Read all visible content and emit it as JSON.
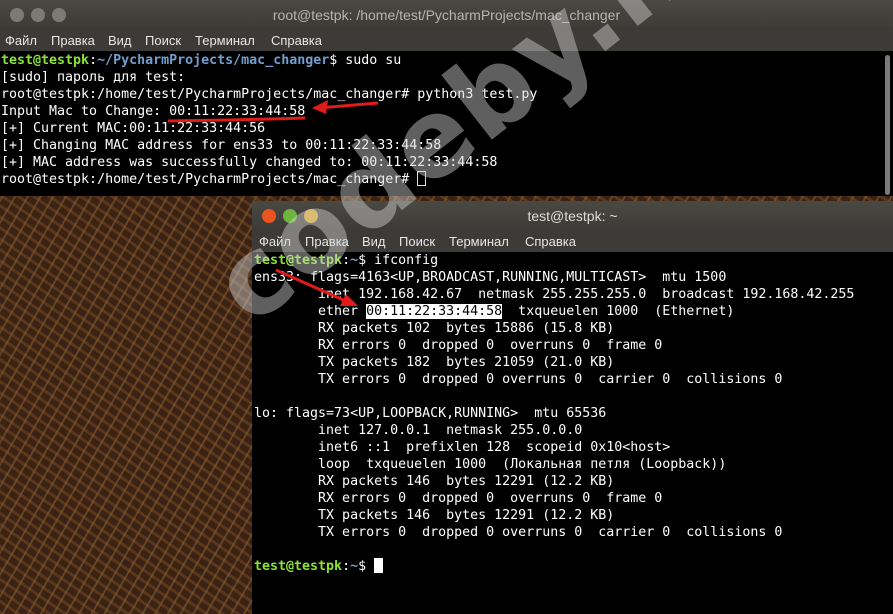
{
  "watermark": "codeby.net",
  "window1": {
    "title": "root@testpk: /home/test/PycharmProjects/mac_changer",
    "menu": [
      "Файл",
      "Правка",
      "Вид",
      "Поиск",
      "Терминал",
      "Справка"
    ],
    "lines": [
      {
        "user": "test@testpk",
        "path": "~/PycharmProjects/mac_changer",
        "prompt": "$ ",
        "text": "sudo su"
      },
      {
        "text": "[sudo] пароль для test:"
      },
      {
        "text": "root@testpk:/home/test/PycharmProjects/mac_changer# python3 test.py"
      },
      {
        "pre": "Input Mac to Change: ",
        "mac": "00:11:22:33:44:58"
      },
      {
        "text": "[+] Current MAC:00:11:22:33:44:56"
      },
      {
        "text": "[+] Changing MAC address for ens33 to 00:11:22:33:44:58"
      },
      {
        "text": "[+] MAC address was successfully changed to: 00:11:22:33:44:58"
      },
      {
        "text": "root@testpk:/home/test/PycharmProjects/mac_changer# "
      }
    ]
  },
  "window2": {
    "title": "test@testpk: ~",
    "menu": [
      "Файл",
      "Правка",
      "Вид",
      "Поиск",
      "Терминал",
      "Справка"
    ],
    "lines": [
      {
        "user": "test@testpk",
        "path": "~",
        "prompt": "$ ",
        "text": "ifconfig"
      },
      {
        "text": "ens33: flags=4163<UP,BROADCAST,RUNNING,MULTICAST>  mtu 1500"
      },
      {
        "text": "        inet 192.168.42.67  netmask 255.255.255.0  broadcast 192.168.42.255"
      },
      {
        "pre": "        ether ",
        "mac": "00:11:22:33:44:58",
        "post": "  txqueuelen 1000  (Ethernet)"
      },
      {
        "text": "        RX packets 102  bytes 15886 (15.8 KB)"
      },
      {
        "text": "        RX errors 0  dropped 0  overruns 0  frame 0"
      },
      {
        "text": "        TX packets 182  bytes 21059 (21.0 KB)"
      },
      {
        "text": "        TX errors 0  dropped 0 overruns 0  carrier 0  collisions 0"
      },
      {
        "text": ""
      },
      {
        "text": "lo: flags=73<UP,LOOPBACK,RUNNING>  mtu 65536"
      },
      {
        "text": "        inet 127.0.0.1  netmask 255.0.0.0"
      },
      {
        "text": "        inet6 ::1  prefixlen 128  scopeid 0x10<host>"
      },
      {
        "text": "        loop  txqueuelen 1000  (Локальная петля (Loopback))"
      },
      {
        "text": "        RX packets 146  bytes 12291 (12.2 KB)"
      },
      {
        "text": "        RX errors 0  dropped 0  overruns 0  frame 0"
      },
      {
        "text": "        TX packets 146  bytes 12291 (12.2 KB)"
      },
      {
        "text": "        TX errors 0  dropped 0 overruns 0  carrier 0  collisions 0"
      },
      {
        "text": ""
      },
      {
        "user": "test@testpk",
        "path": "~",
        "prompt": "$ ",
        "text": ""
      }
    ]
  },
  "colors": {
    "user": "#8ae234",
    "path": "#729fcf",
    "arrow": "#e01b1b",
    "close": "#e95420",
    "minimize": "#e0a81f",
    "maximize": "#6fb43c"
  }
}
